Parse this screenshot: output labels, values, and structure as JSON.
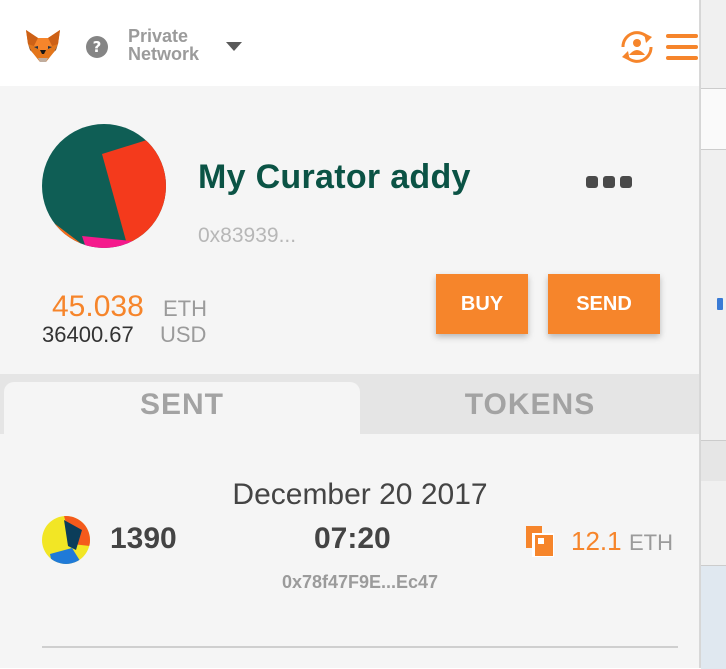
{
  "header": {
    "network_line1": "Private",
    "network_line2": "Network",
    "icons": {
      "logo": "metamask-fox-icon",
      "help": "question-icon",
      "dropdown": "caret-down-icon",
      "accounts": "account-switch-icon",
      "menu": "hamburger-menu-icon"
    }
  },
  "account": {
    "name": "My Curator addy",
    "address": "0x83939...",
    "eth_balance": "45.038",
    "eth_unit": "ETH",
    "usd_balance": "36400.67",
    "usd_unit": "USD",
    "buy_label": "BUY",
    "send_label": "SEND"
  },
  "tabs": [
    {
      "label": "SENT",
      "active": true
    },
    {
      "label": "TOKENS",
      "active": false
    }
  ],
  "transactions": [
    {
      "date": "December 20 2017",
      "nonce": "1390",
      "time": "07:20",
      "hash": "0x78f47F9E...Ec47",
      "value": "12.1",
      "unit": "ETH"
    }
  ],
  "colors": {
    "accent": "#f6852b",
    "account_name": "#0b5345",
    "panel_bg": "#f5f5f5",
    "tab_bar_bg": "#e5e5e5"
  }
}
